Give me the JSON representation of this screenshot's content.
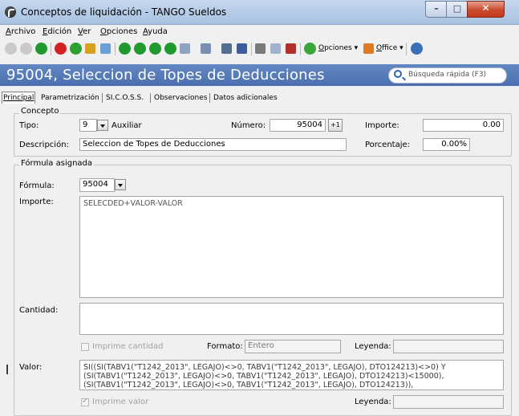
{
  "window": {
    "title": "Conceptos de liquidación - TANGO Sueldos",
    "minimize_glyph": "–",
    "maximize_glyph": "□",
    "close_glyph": "✕"
  },
  "menu": {
    "items": [
      {
        "hot": "A",
        "rest": "rchivo"
      },
      {
        "hot": "E",
        "rest": "dición"
      },
      {
        "hot": "V",
        "rest": "er"
      },
      {
        "hot": "O",
        "rest": "pciones"
      },
      {
        "hot": "A",
        "rest": "yuda"
      }
    ]
  },
  "toolbar": {
    "opciones_hot": "O",
    "opciones_rest": "pciones",
    "office_hot": "O",
    "office_rest": "ffice",
    "dropdown_glyph": "▾"
  },
  "header": {
    "title": "95004, Seleccion de Topes de Deducciones",
    "search_label": "Búsqueda rápida (F3)"
  },
  "tabs": [
    {
      "label": "Principal"
    },
    {
      "label": "Parametrización"
    },
    {
      "label": "SI.C.O.S.S."
    },
    {
      "label": "Observaciones"
    },
    {
      "label": "Datos adicionales"
    }
  ],
  "concepto": {
    "group_title": "Concepto",
    "tipo_label": "Tipo:",
    "tipo_value": "9",
    "tipo_text": "Auxiliar",
    "numero_label": "Número:",
    "numero_value": "95004",
    "calc_glyph": "+1",
    "importe_label": "Importe:",
    "importe_value": "0.00",
    "descripcion_label": "Descripción:",
    "descripcion_value": "Seleccion de Topes de Deducciones",
    "porcentaje_label": "Porcentaje:",
    "porcentaje_value": "0.00%"
  },
  "formula": {
    "group_title": "Fórmula asignada",
    "formula_label": "Fórmula:",
    "formula_value": "95004",
    "importe_label": "Importe:",
    "importe_text": "SELECDED+VALOR-VALOR",
    "cantidad_label": "Cantidad:",
    "cantidad_text": "",
    "imprime_cantidad_label": "Imprime cantidad",
    "imprime_cantidad_checked": false,
    "formato_label": "Formato:",
    "formato_value": "Entero",
    "leyenda_label": "Leyenda:",
    "leyenda_value": "",
    "valor_label": "Valor:",
    "valor_lines": [
      "SI((SI(TABV1(\"T1242_2013\", LEGAJO)<>0, TABV1(\"T1242_2013\", LEGAJO), DTO124213)<>0) Y",
      "(SI(TABV1(\"T1242_2013\", LEGAJO)<>0, TABV1(\"T1242_2013\", LEGAJO), DTO124213)<15000),",
      "(SI(TABV1(\"T1242_2013\", LEGAJO)<>0, TABV1(\"T1242_2013\", LEGAJO), DTO124213)),"
    ],
    "imprime_valor_label": "Imprime valor",
    "imprime_valor_checked": true,
    "leyenda2_label": "Leyenda:",
    "leyenda2_value": ""
  }
}
